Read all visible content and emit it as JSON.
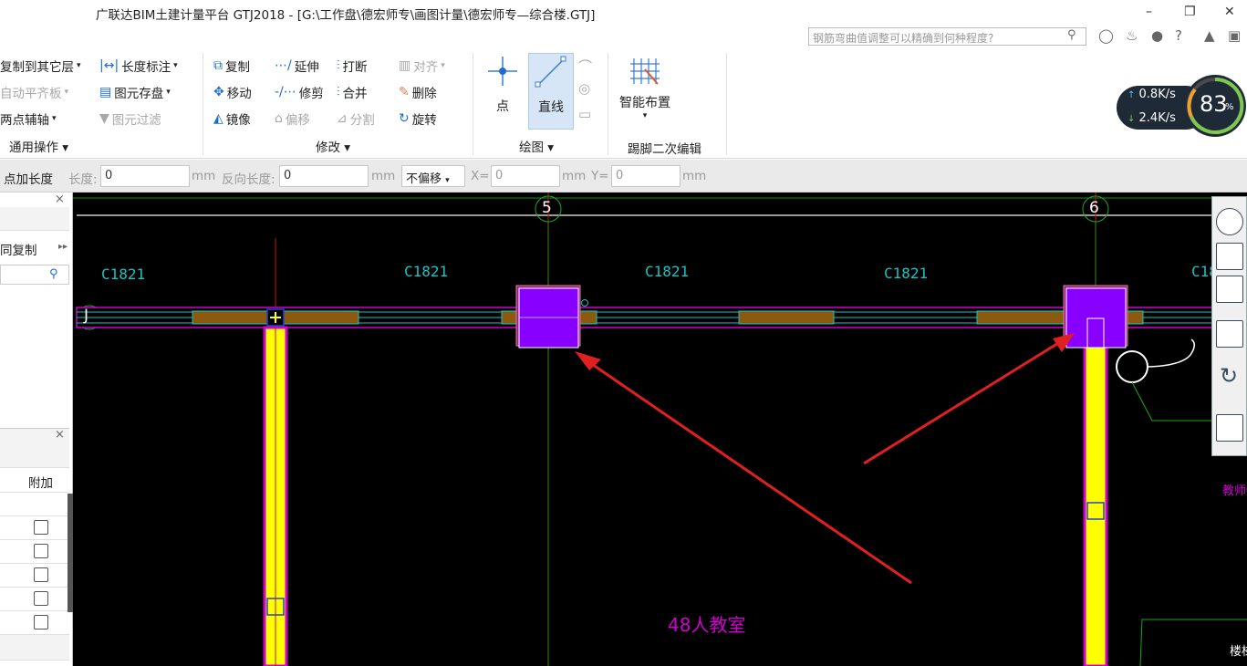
{
  "window": {
    "title": "广联达BIM土建计量平台 GTJ2018 - [G:\\工作盘\\德宏师专\\画图计量\\德宏师专—综合楼.GTJ]",
    "minimize": "–",
    "restore": "❐",
    "close": "✕",
    "search_placeholder": "钢筋弯曲值调整可以精确到何种程度?"
  },
  "ribbon": {
    "common_ops": {
      "copy_to_layer": "复制到其它层",
      "auto_align": "自动平齐板",
      "two_point_axis": "两点辅轴",
      "length_dim": "长度标注",
      "save_element": "图元存盘",
      "element_filter": "图元过滤",
      "group_label": "通用操作"
    },
    "modify": {
      "copy": "复制",
      "extend": "延伸",
      "break": "打断",
      "align": "对齐",
      "move": "移动",
      "trim": "修剪",
      "merge": "合并",
      "delete": "删除",
      "mirror": "镜像",
      "offset": "偏移",
      "split": "分割",
      "rotate": "旋转",
      "group_label": "修改"
    },
    "draw": {
      "point": "点",
      "line": "直线",
      "group_label": "绘图"
    },
    "smart": {
      "smart_layout": "智能布置",
      "group_label": "踢脚二次编辑"
    }
  },
  "network": {
    "up": "0.8K/s",
    "down": "2.4K/s",
    "percent": "83",
    "percent_unit": "%"
  },
  "toolbar": {
    "point_add_length": "点加长度",
    "length_label": "长度:",
    "length_value": "0",
    "unit_mm": "mm",
    "reverse_length_label": "反向长度:",
    "reverse_length_value": "0",
    "offset_select": "不偏移",
    "x_label": "X=",
    "x_value": "0",
    "y_label": "Y=",
    "y_value": "0"
  },
  "left_panel": {
    "copy_label": "同复制",
    "column_header": "附加",
    "close": "×"
  },
  "canvas": {
    "axis_5": "5",
    "axis_6": "6",
    "axis_j": "J",
    "window_labels": [
      "C1821",
      "C1821",
      "C1821",
      "C1821",
      "C18"
    ],
    "room_label": "48人教室",
    "right_label": "教师休",
    "bottom_right_label": "楼梯"
  }
}
